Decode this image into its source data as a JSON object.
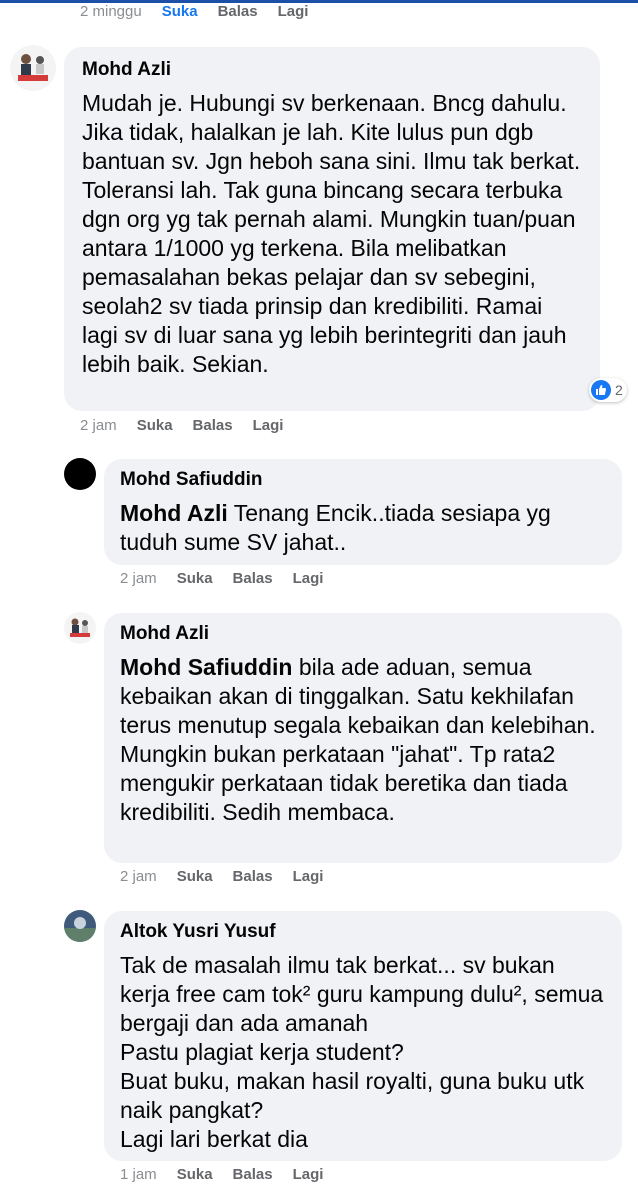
{
  "top_actions": {
    "time": "2 minggu",
    "like": "Suka",
    "reply": "Balas",
    "more": "Lagi"
  },
  "comments": [
    {
      "author": "Mohd Azli",
      "mention": "",
      "text": "Mudah je. Hubungi sv berkenaan. Bncg dahulu. Jika tidak, halalkan je lah. Kite lulus pun dgb bantuan sv. Jgn heboh sana sini. Ilmu tak berkat. Toleransi lah. Tak guna bincang secara terbuka dgn org yg tak pernah alami. Mungkin tuan/puan antara 1/1000 yg terkena. Bila melibatkan pemasalahan bekas pelajar dan sv sebegini, seolah2 sv tiada prinsip dan kredibiliti. Ramai lagi sv di luar sana yg lebih berintegriti dan jauh lebih baik. Sekian.",
      "reaction_count": "2",
      "time": "2 jam",
      "like": "Suka",
      "reply": "Balas",
      "more": "Lagi"
    },
    {
      "author": "Mohd Safiuddin",
      "mention": "Mohd Azli",
      "text": "Tenang Encik..tiada sesiapa yg tuduh sume SV jahat..",
      "time": "2 jam",
      "like": "Suka",
      "reply": "Balas",
      "more": "Lagi"
    },
    {
      "author": "Mohd Azli",
      "mention": "Mohd Safiuddin",
      "text": "bila ade aduan, semua kebaikan akan di tinggalkan. Satu kekhilafan terus menutup segala kebaikan dan kelebihan. Mungkin bukan perkataan \"jahat\". Tp rata2 mengukir perkataan tidak beretika dan tiada kredibiliti. Sedih membaca.",
      "time": "2 jam",
      "like": "Suka",
      "reply": "Balas",
      "more": "Lagi"
    },
    {
      "author": "Altok Yusri Yusuf",
      "mention": "",
      "text": "Tak de masalah ilmu tak berkat... sv bukan kerja free cam tok² guru kampung dulu², semua bergaji dan ada amanah\nPastu plagiat kerja student?\nBuat buku, makan hasil royalti, guna buku utk naik pangkat?\nLagi lari berkat dia",
      "time": "1 jam",
      "like": "Suka",
      "reply": "Balas",
      "more": "Lagi"
    }
  ],
  "colors": {
    "bubble": "#f0f2f5",
    "link_blue": "#1877f2",
    "meta_gray": "#65676b"
  }
}
